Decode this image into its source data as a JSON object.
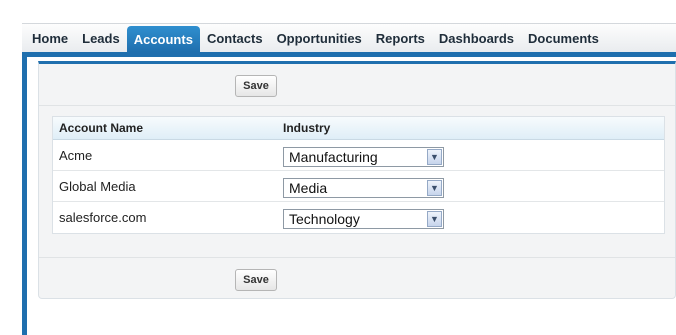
{
  "tabs": [
    {
      "label": "Home",
      "active": false
    },
    {
      "label": "Leads",
      "active": false
    },
    {
      "label": "Accounts",
      "active": true
    },
    {
      "label": "Contacts",
      "active": false
    },
    {
      "label": "Opportunities",
      "active": false
    },
    {
      "label": "Reports",
      "active": false
    },
    {
      "label": "Dashboards",
      "active": false
    },
    {
      "label": "Documents",
      "active": false
    }
  ],
  "toolbar": {
    "save_label": "Save"
  },
  "table": {
    "headers": [
      "Account Name",
      "Industry"
    ],
    "rows": [
      {
        "name": "Acme",
        "industry": "Manufacturing"
      },
      {
        "name": "Global Media",
        "industry": "Media"
      },
      {
        "name": "salesforce.com",
        "industry": "Technology"
      }
    ]
  },
  "colors": {
    "accent": "#1f6fae",
    "header_bg": "#dfeef7"
  },
  "icons": {
    "dropdown": "chevron-down-icon"
  }
}
